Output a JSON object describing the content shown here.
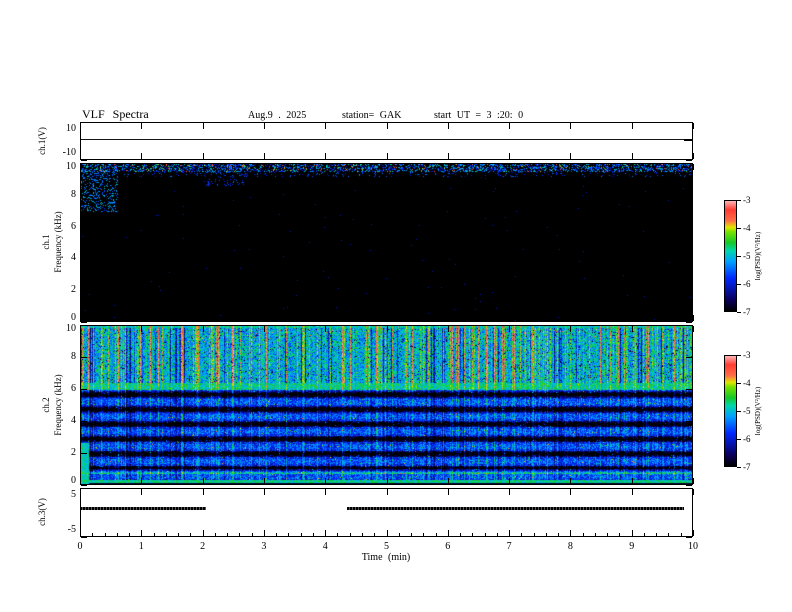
{
  "header": {
    "title": "VLF Spectra",
    "date": "Aug.9 . 2025",
    "station": "station= GAK",
    "start_ut": "start UT = 3 :20: 0"
  },
  "xaxis": {
    "label": "Time (min)",
    "range": [
      0,
      10
    ],
    "ticks": [
      0,
      1,
      2,
      3,
      4,
      5,
      6,
      7,
      8,
      9,
      10
    ]
  },
  "colorbar": {
    "label": "log(PSD)(V²/Hz)",
    "range": [
      -7,
      -3
    ],
    "ticks": [
      -3,
      -4,
      -5,
      -6,
      -7
    ]
  },
  "chart_data": [
    {
      "type": "line",
      "name": "ch1-voltage",
      "ylabel": "ch.1(V)",
      "ylim": [
        -10,
        10
      ],
      "yticks": [
        10,
        -10
      ],
      "trace": {
        "value": 1,
        "segments": [
          [
            0,
            10
          ]
        ],
        "note": "flat thin trace across the full record with a small dark blip at the right edge"
      }
    },
    {
      "type": "heatmap",
      "name": "ch1-spectrogram",
      "ylabel": "Frequency (kHz)",
      "ylabel_outer": "ch.1",
      "ylim": [
        0,
        10
      ],
      "yticks": [
        0,
        2,
        4,
        6,
        8,
        10
      ],
      "zlabel": "log(PSD)(V²/Hz)",
      "zlim": [
        -7,
        -3
      ],
      "description": "almost entirely at the -7 noise floor (black); sparse impulsive multicolour speckle confined to 9.5-10 kHz; faint green wisps 7-9.7 kHz during the first ~0.5 min and near 2.2-2.7 min"
    },
    {
      "type": "heatmap",
      "name": "ch2-spectrogram",
      "ylabel": "Frequency (kHz)",
      "ylabel_outer": "ch.2",
      "ylim": [
        0,
        10
      ],
      "yticks": [
        0,
        2,
        4,
        6,
        8,
        10
      ],
      "zlabel": "log(PSD)(V²/Hz)",
      "zlim": [
        -7,
        -3
      ],
      "description": "broadband noise: green field with dense vertical sferic streaks above ~6.4 kHz, brighter band 6-6.4 kHz, blue speckle with dark horizontal stripes every ~0.95 kHz below 6 kHz, bright green line near 0.2 kHz and enhancement near 0.8 kHz"
    },
    {
      "type": "line",
      "name": "ch3-voltage",
      "ylabel": "ch.3(V)",
      "ylim": [
        -5,
        5
      ],
      "yticks": [
        5,
        -5
      ],
      "trace": {
        "value": 1,
        "segments": [
          [
            0,
            2.05
          ],
          [
            4.35,
            9.85
          ]
        ],
        "note": "dotted trace near +1 V with a gap from ~2.05 to ~4.35 min"
      }
    }
  ]
}
